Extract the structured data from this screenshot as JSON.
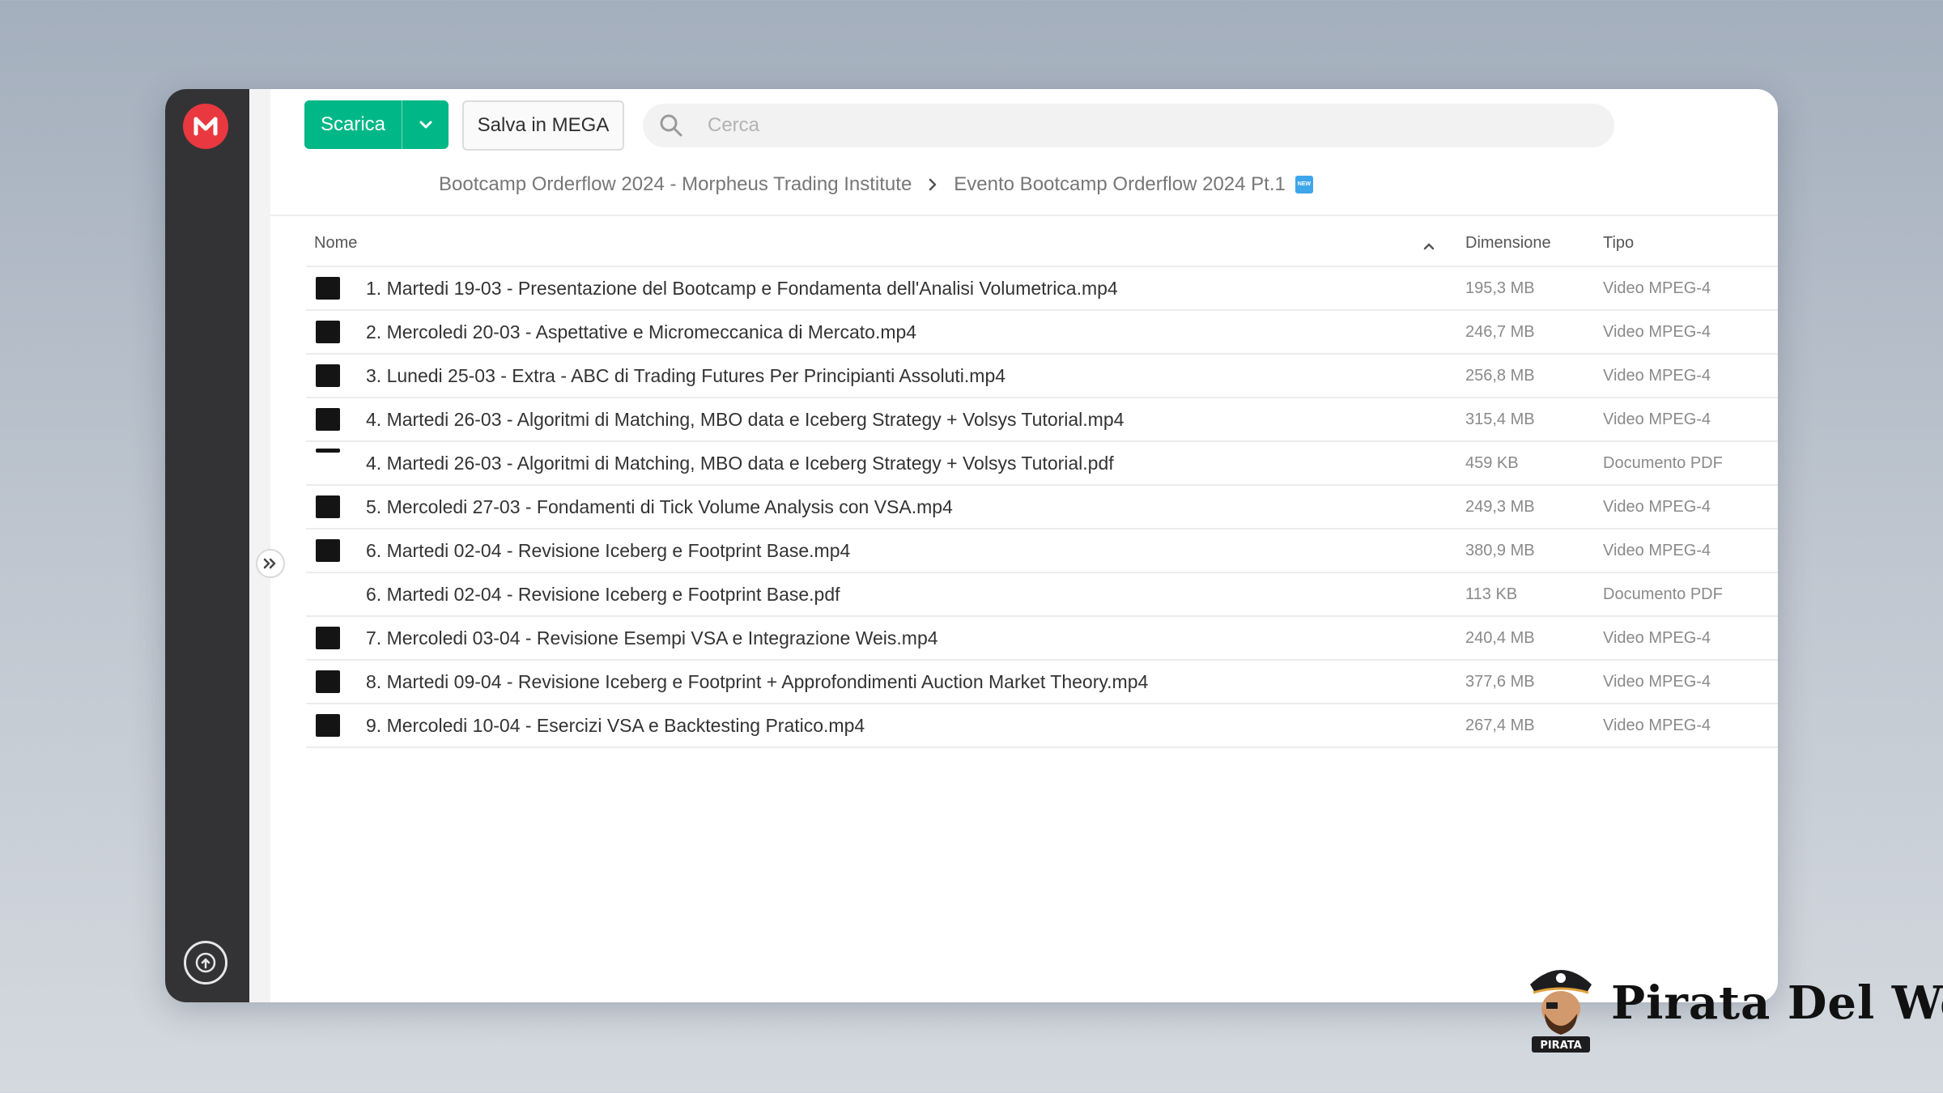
{
  "toolbar": {
    "download_label": "Scarica",
    "save_label": "Salva in MEGA",
    "search_placeholder": "Cerca"
  },
  "breadcrumb": {
    "parent": "Bootcamp Orderflow 2024 - Morpheus Trading Institute",
    "current": "Evento Bootcamp Orderflow 2024 Pt.1",
    "badge": "NEW"
  },
  "table": {
    "columns": {
      "name": "Nome",
      "size": "Dimensione",
      "type": "Tipo"
    },
    "rows": [
      {
        "name": "1. Martedi 19-03 - Presentazione del Bootcamp e Fondamenta dell'Analisi Volumetrica.mp4",
        "size": "195,3 MB",
        "type": "Video MPEG-4",
        "thumb": "video"
      },
      {
        "name": "2. Mercoledi 20-03 - Aspettative e Micromeccanica di Mercato.mp4",
        "size": "246,7 MB",
        "type": "Video MPEG-4",
        "thumb": "video"
      },
      {
        "name": "3. Lunedi 25-03 - Extra - ABC di Trading Futures Per Principianti Assoluti.mp4",
        "size": "256,8 MB",
        "type": "Video MPEG-4",
        "thumb": "video"
      },
      {
        "name": "4. Martedi 26-03 - Algoritmi di Matching, MBO data e Iceberg Strategy + Volsys Tutorial.mp4",
        "size": "315,4 MB",
        "type": "Video MPEG-4",
        "thumb": "video"
      },
      {
        "name": "4. Martedi 26-03 - Algoritmi di Matching, MBO data e Iceberg Strategy + Volsys Tutorial.pdf",
        "size": "459 KB",
        "type": "Documento PDF",
        "thumb": "pdf"
      },
      {
        "name": "5. Mercoledi 27-03 - Fondamenti di Tick Volume Analysis con VSA.mp4",
        "size": "249,3 MB",
        "type": "Video MPEG-4",
        "thumb": "video"
      },
      {
        "name": "6. Martedi 02-04 - Revisione Iceberg e Footprint Base.mp4",
        "size": "380,9 MB",
        "type": "Video MPEG-4",
        "thumb": "video"
      },
      {
        "name": "6. Martedi 02-04 - Revisione Iceberg e Footprint Base.pdf",
        "size": "113 KB",
        "type": "Documento PDF",
        "thumb": "none"
      },
      {
        "name": "7. Mercoledi 03-04 - Revisione Esempi VSA e Integrazione Weis.mp4",
        "size": "240,4 MB",
        "type": "Video MPEG-4",
        "thumb": "video"
      },
      {
        "name": "8. Martedi 09-04 - Revisione Iceberg e Footprint + Approfondimenti Auction Market Theory.mp4",
        "size": "377,6 MB",
        "type": "Video MPEG-4",
        "thumb": "video"
      },
      {
        "name": "9. Mercoledi 10-04 - Esercizi VSA e Backtesting Pratico.mp4",
        "size": "267,4 MB",
        "type": "Video MPEG-4",
        "thumb": "video"
      }
    ]
  },
  "watermark": {
    "text": "Pirata Del Web",
    "badge_text": "PIRATA"
  },
  "colors": {
    "download_button": "#00b887",
    "mega_logo": "#e9383f",
    "sidebar": "#333335",
    "new_badge": "#3ea6ea"
  },
  "icons": {
    "logo": "mega-logo-icon",
    "search": "search-icon",
    "dropdown": "chevron-down-icon",
    "breadcrumb_separator": "chevron-right-icon",
    "sort": "sort-ascending-icon",
    "expand": "double-chevron-right-icon",
    "sync": "sync-icon"
  }
}
